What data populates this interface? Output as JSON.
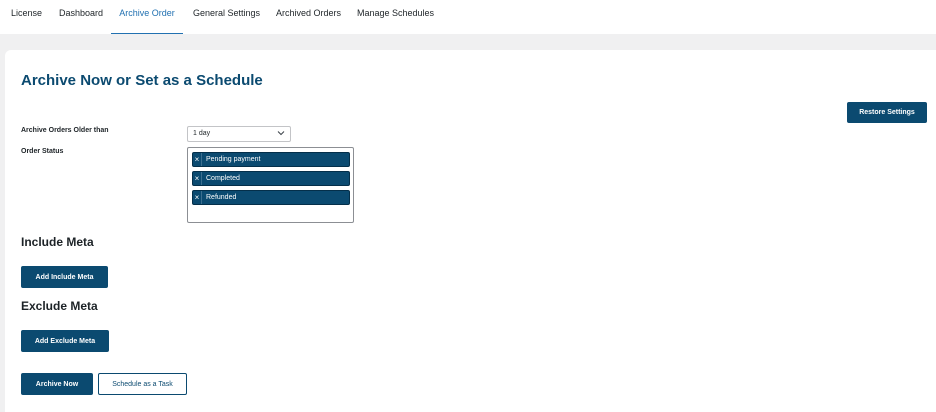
{
  "nav": {
    "tabs": [
      {
        "label": "License",
        "active": false
      },
      {
        "label": "Dashboard",
        "active": false
      },
      {
        "label": "Archive Order",
        "active": true
      },
      {
        "label": "General Settings",
        "active": false
      },
      {
        "label": "Archived Orders",
        "active": false
      },
      {
        "label": "Manage Schedules",
        "active": false
      }
    ]
  },
  "page": {
    "title": "Archive Now or Set as a Schedule",
    "restore_label": "Restore Settings"
  },
  "form": {
    "older_than_label": "Archive Orders Older than",
    "older_than_value": "1 day",
    "order_status_label": "Order Status",
    "statuses": [
      {
        "remove": "×",
        "label": "Pending payment"
      },
      {
        "remove": "×",
        "label": "Completed"
      },
      {
        "remove": "×",
        "label": "Refunded"
      }
    ]
  },
  "include_meta": {
    "title": "Include Meta",
    "button_label": "Add Include Meta"
  },
  "exclude_meta": {
    "title": "Exclude Meta",
    "button_label": "Add Exclude Meta"
  },
  "actions": {
    "archive_now_label": "Archive Now",
    "schedule_label": "Schedule as a Task"
  },
  "colors": {
    "primary": "#0b4a70",
    "active_tab": "#2271b1",
    "background": "#f0f0f1"
  },
  "icons": {
    "select_arrow": "chevron-down-icon",
    "chip_remove": "close-icon"
  }
}
